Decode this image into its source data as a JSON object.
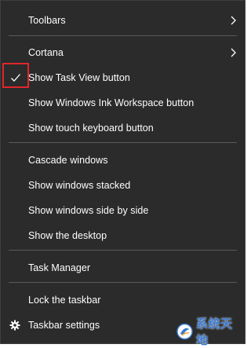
{
  "context_menu": {
    "items": [
      {
        "label": "Toolbars",
        "has_submenu": true
      },
      {
        "label": "Cortana",
        "has_submenu": true
      },
      {
        "label": "Show Task View button",
        "checked": true
      },
      {
        "label": "Show Windows Ink Workspace button"
      },
      {
        "label": "Show touch keyboard button"
      },
      {
        "label": "Cascade windows"
      },
      {
        "label": "Show windows stacked"
      },
      {
        "label": "Show windows side by side"
      },
      {
        "label": "Show the desktop"
      },
      {
        "label": "Task Manager"
      },
      {
        "label": "Lock the taskbar"
      },
      {
        "label": "Taskbar settings",
        "icon": "gear-icon"
      }
    ]
  },
  "highlight_color": "#e0262b",
  "watermark": {
    "text": "系统天地"
  }
}
